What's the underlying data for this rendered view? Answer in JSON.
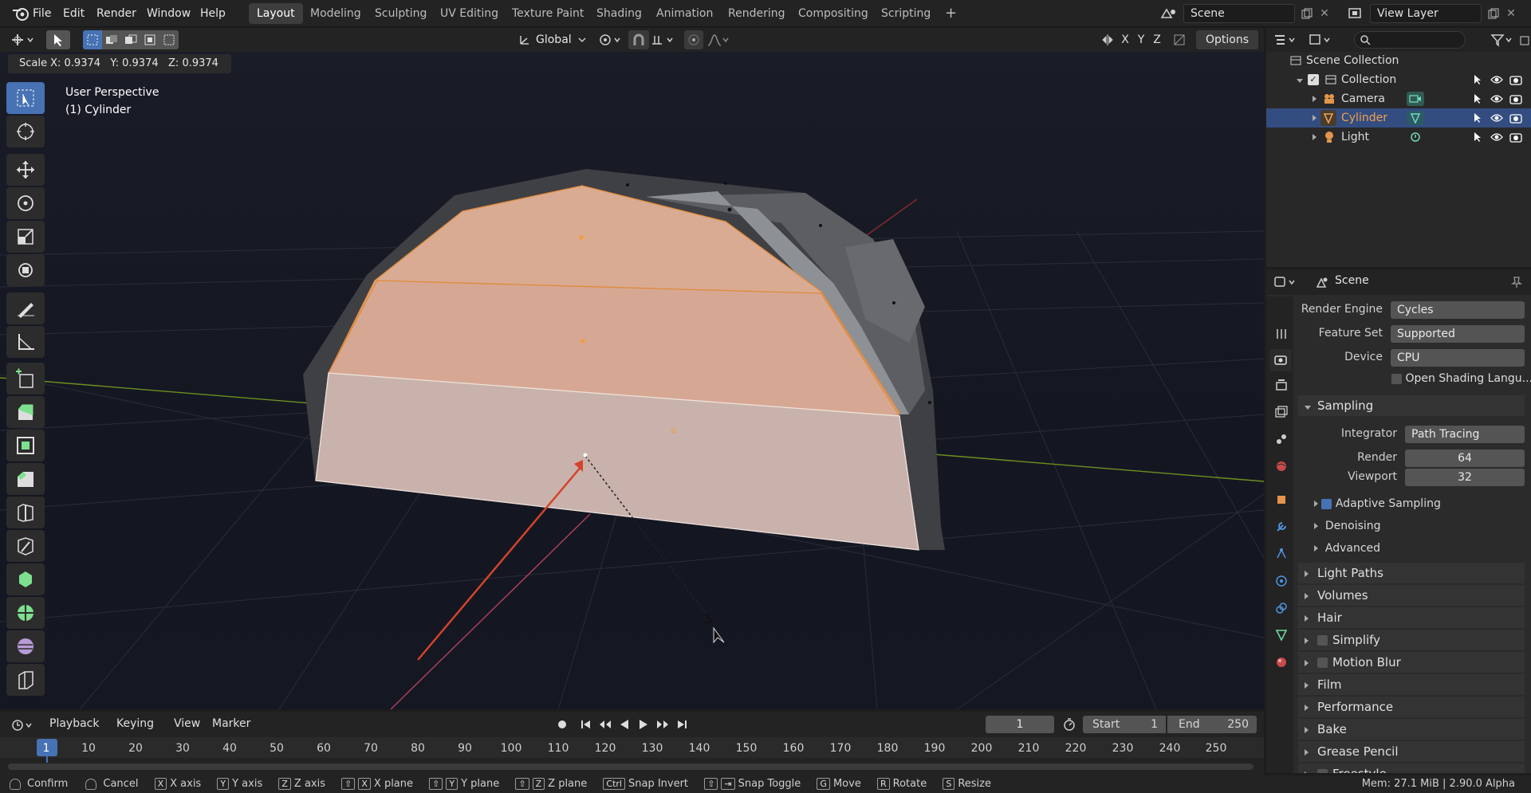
{
  "menu": {
    "items": [
      "File",
      "Edit",
      "Render",
      "Window",
      "Help"
    ]
  },
  "workspaces": [
    "Layout",
    "Modeling",
    "Sculpting",
    "UV Editing",
    "Texture Paint",
    "Shading",
    "Animation",
    "Rendering",
    "Compositing",
    "Scripting"
  ],
  "topright": {
    "scene": "Scene",
    "view_layer": "View Layer"
  },
  "viewport_header": {
    "transform_orientation": "Global",
    "options": "Options",
    "axes": [
      "X",
      "Y",
      "Z"
    ]
  },
  "operator_readout": "Scale X: 0.9374   Y: 0.9374   Z: 0.9374",
  "viewport_overlay": {
    "view_name": "User Perspective",
    "object_name": "(1) Cylinder"
  },
  "outliner": {
    "scene_collection": "Scene Collection",
    "collection": "Collection",
    "items": [
      {
        "name": "Camera"
      },
      {
        "name": "Cylinder"
      },
      {
        "name": "Light"
      }
    ]
  },
  "properties": {
    "context": "Scene",
    "render_engine_label": "Render Engine",
    "render_engine": "Cycles",
    "feature_set_label": "Feature Set",
    "feature_set": "Supported",
    "device_label": "Device",
    "device": "CPU",
    "osl": "Open Shading Langu...",
    "sampling": "Sampling",
    "integrator_label": "Integrator",
    "integrator": "Path Tracing",
    "render_label": "Render",
    "render_samples": "64",
    "viewport_label": "Viewport",
    "viewport_samples": "32",
    "adaptive": "Adaptive Sampling",
    "denoising": "Denoising",
    "advanced": "Advanced",
    "panels": [
      "Light Paths",
      "Volumes",
      "Hair",
      "Simplify",
      "Motion Blur",
      "Film",
      "Performance",
      "Bake",
      "Grease Pencil",
      "Freestyle"
    ]
  },
  "timeline": {
    "menus": [
      "Playback",
      "Keying",
      "View",
      "Marker"
    ],
    "current_frame": "1",
    "start_label": "Start",
    "start": "1",
    "end_label": "End",
    "end": "250",
    "ruler": [
      "1",
      "10",
      "20",
      "30",
      "40",
      "50",
      "60",
      "70",
      "80",
      "90",
      "100",
      "110",
      "120",
      "130",
      "140",
      "150",
      "160",
      "170",
      "180",
      "190",
      "200",
      "210",
      "220",
      "230",
      "240",
      "250"
    ]
  },
  "statusbar": {
    "items": [
      {
        "keys": [],
        "label": "Confirm"
      },
      {
        "keys": [],
        "label": "Cancel"
      },
      {
        "keys": [
          "X"
        ],
        "label": "X axis"
      },
      {
        "keys": [
          "Y"
        ],
        "label": "Y axis"
      },
      {
        "keys": [
          "Z"
        ],
        "label": "Z axis"
      },
      {
        "keys": [
          "⇧",
          "X"
        ],
        "label": "X plane"
      },
      {
        "keys": [
          "⇧",
          "Y"
        ],
        "label": "Y plane"
      },
      {
        "keys": [
          "⇧",
          "Z"
        ],
        "label": "Z plane"
      },
      {
        "keys": [
          "Ctrl"
        ],
        "label": "Snap Invert"
      },
      {
        "keys": [
          "⇧",
          "⇥"
        ],
        "label": "Snap Toggle"
      },
      {
        "keys": [
          "G"
        ],
        "label": "Move"
      },
      {
        "keys": [
          "R"
        ],
        "label": "Rotate"
      },
      {
        "keys": [
          "S"
        ],
        "label": "Resize"
      }
    ],
    "memory": "Mem: 27.1 MiB | 2.90.0 Alpha"
  },
  "colors": {
    "accent": "#4772b3",
    "selected_orange": "#f0a050",
    "face_select": "#d9b7a7"
  }
}
